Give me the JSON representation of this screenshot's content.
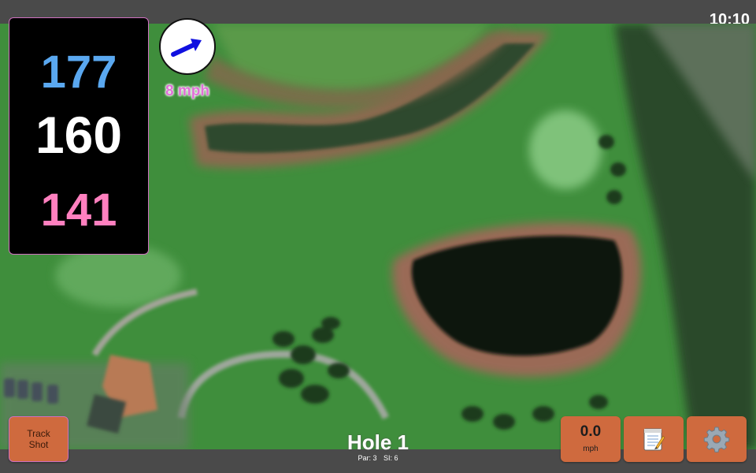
{
  "status_bar": {
    "time": "10:10"
  },
  "distances": {
    "back": "177",
    "middle": "160",
    "front": "141"
  },
  "wind": {
    "speed_label": "8 mph",
    "arrow_direction": "east-northeast"
  },
  "hole": {
    "title": "Hole 1",
    "par_label": "Par: 3",
    "si_label": "SI: 6"
  },
  "buttons": {
    "track_shot_line1": "Track",
    "track_shot_line2": "Shot",
    "wind_value": "0.0",
    "wind_unit": "mph",
    "notes_icon": "notepad-icon",
    "settings_icon": "gear-icon"
  },
  "colors": {
    "back_distance": "#5aa8f0",
    "middle_distance": "#ffffff",
    "front_distance": "#ff80bf",
    "button": "#cf6a3e",
    "wind_text": "#e070d8"
  }
}
